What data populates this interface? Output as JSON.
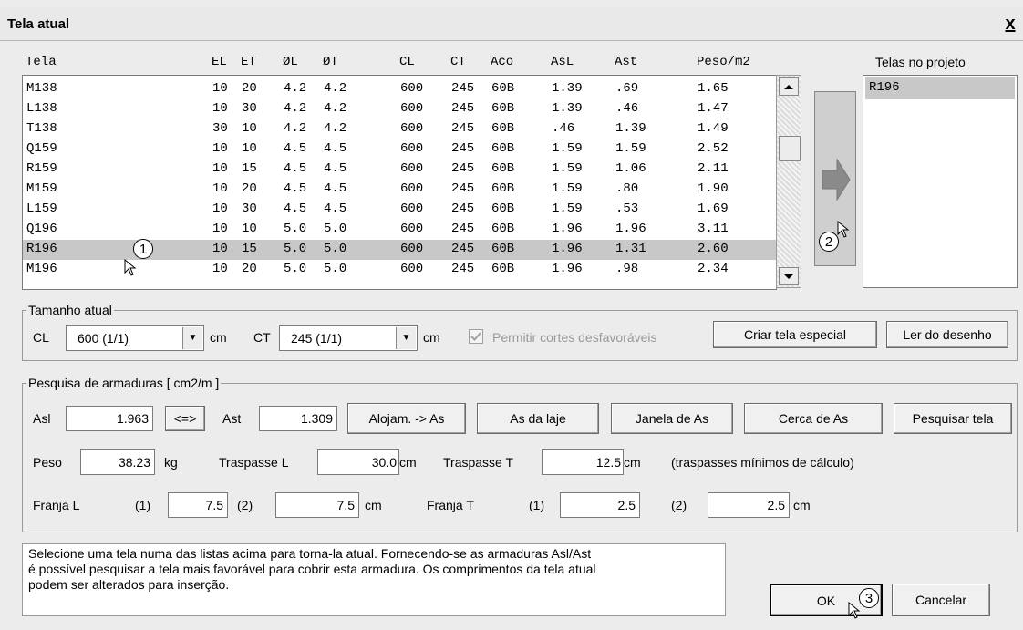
{
  "window": {
    "title": "Tela atual",
    "close_label": "x"
  },
  "table": {
    "headers": [
      "Tela",
      "EL",
      "ET",
      "ØL",
      "ØT",
      "CL",
      "CT",
      "Aco",
      "AsL",
      "Ast",
      "Peso/m2"
    ],
    "rows": [
      [
        "M138",
        "10",
        "20",
        "4.2",
        "4.2",
        "600",
        "245",
        "60B",
        "1.39",
        ".69",
        "1.65"
      ],
      [
        "L138",
        "10",
        "30",
        "4.2",
        "4.2",
        "600",
        "245",
        "60B",
        "1.39",
        ".46",
        "1.47"
      ],
      [
        "T138",
        "30",
        "10",
        "4.2",
        "4.2",
        "600",
        "245",
        "60B",
        ".46",
        "1.39",
        "1.49"
      ],
      [
        "Q159",
        "10",
        "10",
        "4.5",
        "4.5",
        "600",
        "245",
        "60B",
        "1.59",
        "1.59",
        "2.52"
      ],
      [
        "R159",
        "10",
        "15",
        "4.5",
        "4.5",
        "600",
        "245",
        "60B",
        "1.59",
        "1.06",
        "2.11"
      ],
      [
        "M159",
        "10",
        "20",
        "4.5",
        "4.5",
        "600",
        "245",
        "60B",
        "1.59",
        ".80",
        "1.90"
      ],
      [
        "L159",
        "10",
        "30",
        "4.5",
        "4.5",
        "600",
        "245",
        "60B",
        "1.59",
        ".53",
        "1.69"
      ],
      [
        "Q196",
        "10",
        "10",
        "5.0",
        "5.0",
        "600",
        "245",
        "60B",
        "1.96",
        "1.96",
        "3.11"
      ],
      [
        "R196",
        "10",
        "15",
        "5.0",
        "5.0",
        "600",
        "245",
        "60B",
        "1.96",
        "1.31",
        "2.60"
      ],
      [
        "M196",
        "10",
        "20",
        "5.0",
        "5.0",
        "600",
        "245",
        "60B",
        "1.96",
        ".98",
        "2.34"
      ]
    ],
    "selected_row": 8
  },
  "project": {
    "title": "Telas no projeto",
    "items": [
      "R196"
    ]
  },
  "tamanho": {
    "legend": "Tamanho atual",
    "cl_label": "CL",
    "cl_value": "600 (1/1)",
    "cl_unit": "cm",
    "ct_label": "CT",
    "ct_value": "245 (1/1)",
    "ct_unit": "cm",
    "checkbox_label": "Permitir cortes desfavoráveis",
    "btn_criar": "Criar tela especial",
    "btn_ler": "Ler do desenho"
  },
  "pesquisa": {
    "legend": "Pesquisa de armaduras  [ cm2/m ]",
    "asl_label": "Asl",
    "asl_value": "1.963",
    "swap_label": "<=>",
    "ast_label": "Ast",
    "ast_value": "1.309",
    "btn_alojam": "Alojam. -> As",
    "btn_aslaje": "As da laje",
    "btn_janela": "Janela de As",
    "btn_cerca": "Cerca de As",
    "btn_pesquisar": "Pesquisar tela",
    "peso_label": "Peso",
    "peso_value": "38.23",
    "peso_unit": "kg",
    "trasl_label": "Traspasse L",
    "trasl_value": "30.0",
    "trasl_unit": "cm",
    "trast_label": "Traspasse T",
    "trast_value": "12.5",
    "trast_unit": "cm",
    "traspasse_note": "(traspasses mínimos de cálculo)",
    "franjal_label": "Franja L",
    "franjal_1_label": "(1)",
    "franjal_1_value": "7.5",
    "franjal_2_label": "(2)",
    "franjal_2_value": "7.5",
    "franjal_unit": "cm",
    "franjat_label": "Franja T",
    "franjat_1_label": "(1)",
    "franjat_1_value": "2.5",
    "franjat_2_label": "(2)",
    "franjat_2_value": "2.5",
    "franjat_unit": "cm"
  },
  "info": {
    "line1": "Selecione uma tela numa das listas acima para torna-la atual. Fornecendo-se as armaduras Asl/Ast",
    "line2": "é possível pesquisar a tela mais favorável para cobrir esta armadura. Os comprimentos da tela atual",
    "line3": "podem ser alterados para inserção."
  },
  "buttons": {
    "ok": "OK",
    "cancel": "Cancelar"
  },
  "callouts": [
    "1",
    "2",
    "3"
  ]
}
